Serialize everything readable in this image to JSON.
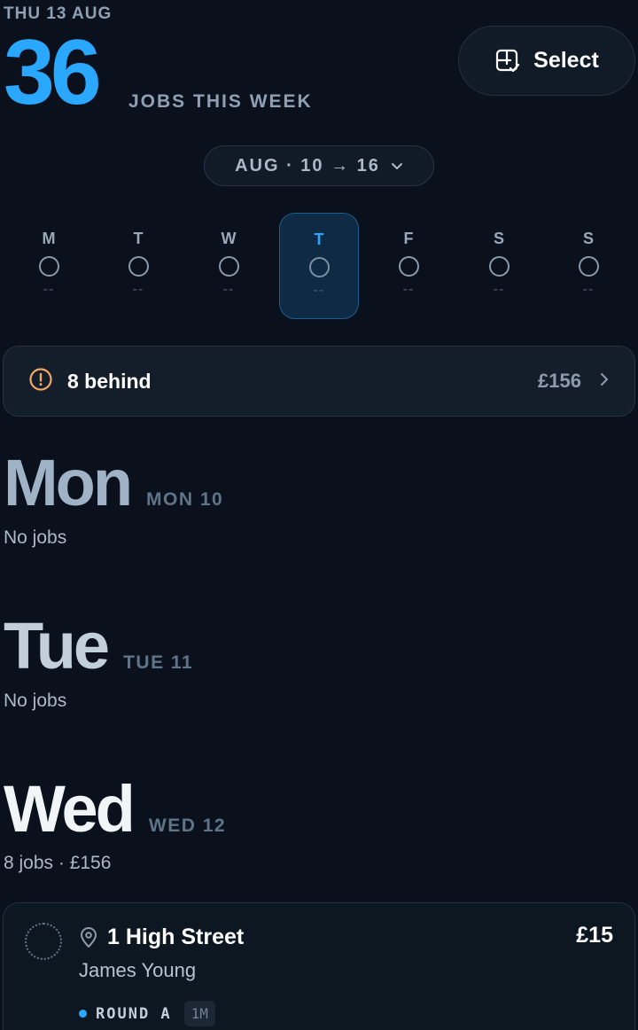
{
  "header": {
    "date_label": "THU 13 AUG",
    "job_count": "36",
    "job_count_label": "JOBS THIS WEEK",
    "select_label": "Select",
    "select_icon": "grid-check-icon"
  },
  "week_range": {
    "label": "AUG · 10 → 16",
    "icon": "chevron-down-icon"
  },
  "week_days": [
    {
      "letter": "M",
      "value": "--",
      "active": false
    },
    {
      "letter": "T",
      "value": "--",
      "active": false
    },
    {
      "letter": "W",
      "value": "--",
      "active": false
    },
    {
      "letter": "T",
      "value": "--",
      "active": true
    },
    {
      "letter": "F",
      "value": "--",
      "active": false
    },
    {
      "letter": "S",
      "value": "--",
      "active": false
    },
    {
      "letter": "S",
      "value": "--",
      "active": false
    }
  ],
  "behind": {
    "label": "8 behind",
    "amount": "£156",
    "icon": "warning-circle-icon"
  },
  "days": [
    {
      "big": "Mon",
      "small": "MON 10",
      "summary": "No jobs",
      "color": "#9fb2c6"
    },
    {
      "big": "Tue",
      "small": "TUE 11",
      "summary": "No jobs",
      "color": "#c3cedb"
    },
    {
      "big": "Wed",
      "small": "WED 12",
      "summary": "8 jobs · £156",
      "color": "#f2f5f8"
    }
  ],
  "job": {
    "address": "1 High Street",
    "customer": "James Young",
    "price": "£15",
    "round": "ROUND A",
    "frequency": "1M"
  },
  "colors": {
    "accent": "#2aa8ff",
    "warning": "#f0a868",
    "background": "#0a111c"
  }
}
